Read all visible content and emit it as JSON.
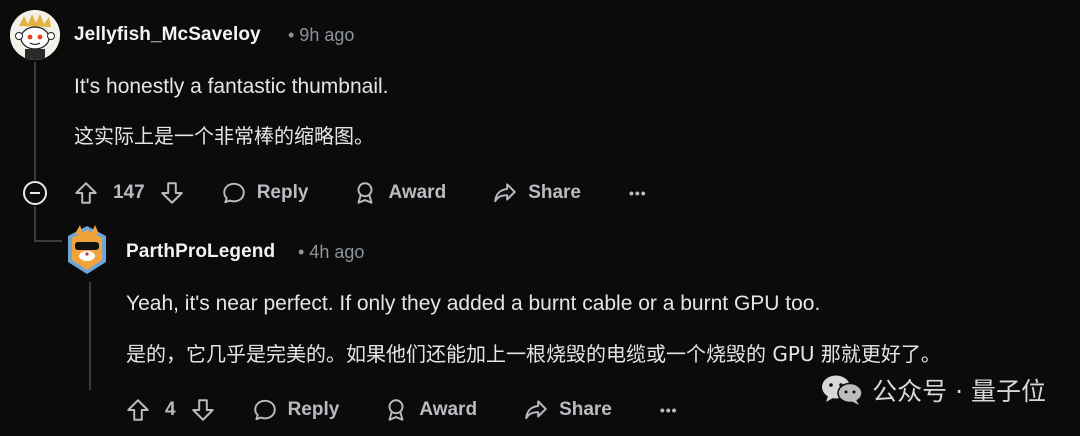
{
  "comments": [
    {
      "username": "Jellyfish_McSaveloy",
      "time": "• 9h ago",
      "text_en": "It's honestly a fantastic thumbnail.",
      "text_zh": "这实际上是一个非常棒的缩略图。",
      "votes": "147",
      "reply_label": "Reply",
      "award_label": "Award",
      "share_label": "Share",
      "more_label": "•••"
    },
    {
      "username": "ParthProLegend",
      "time": "• 4h ago",
      "text_en": "Yeah, it's near perfect. If only they added a burnt cable or a burnt GPU too.",
      "text_zh": "是的，它几乎是完美的。如果他们还能加上一根烧毁的电缆或一个烧毁的 GPU 那就更好了。",
      "votes": "4",
      "reply_label": "Reply",
      "award_label": "Award",
      "share_label": "Share",
      "more_label": "•••"
    }
  ],
  "watermark": {
    "text": "公众号 · 量子位"
  },
  "colors": {
    "background": "#0b0b0b",
    "muted": "#8e949b",
    "text": "#e3e6e8"
  }
}
